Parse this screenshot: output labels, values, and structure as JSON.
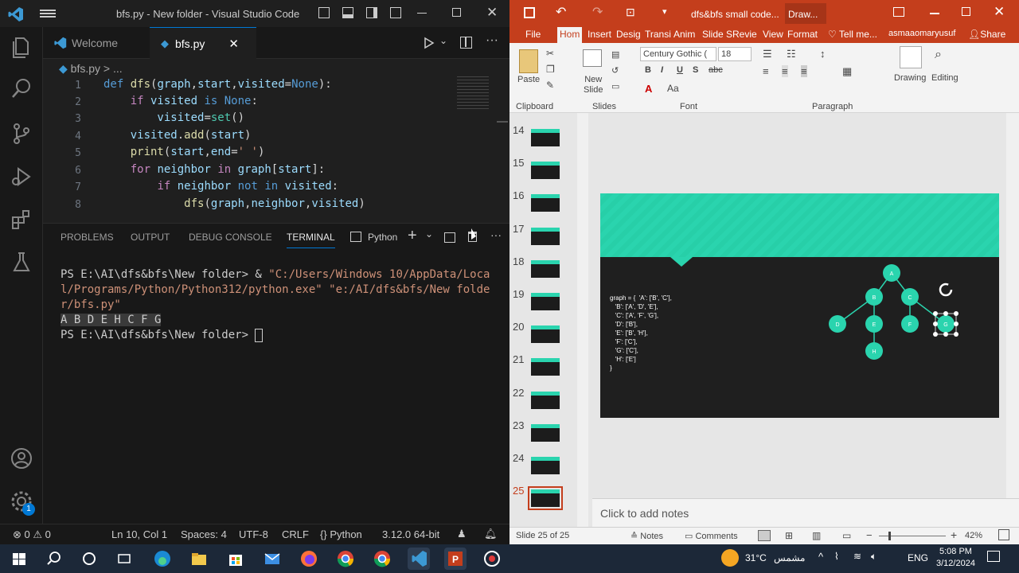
{
  "vscode": {
    "title": "bfs.py - New folder - Visual Studio Code",
    "tabs": [
      {
        "label": "Welcome"
      },
      {
        "label": "bfs.py"
      }
    ],
    "breadcrumb": {
      "file": "bfs.py",
      "rest": "..."
    },
    "code_lines": [
      {
        "n": "1",
        "text": "def dfs(graph,start,visited=None):"
      },
      {
        "n": "2",
        "text": "    if visited is None:"
      },
      {
        "n": "3",
        "text": "        visited=set()"
      },
      {
        "n": "4",
        "text": "    visited.add(start)"
      },
      {
        "n": "5",
        "text": "    print(start,end=' ')"
      },
      {
        "n": "6",
        "text": "    for neighbor in graph[start]:"
      },
      {
        "n": "7",
        "text": "        if neighbor not in visited:"
      },
      {
        "n": "8",
        "text": "            dfs(graph,neighbor,visited)"
      }
    ],
    "panel_tabs": {
      "problems": "PROBLEMS",
      "output": "OUTPUT",
      "debug": "DEBUG CONSOLE",
      "terminal": "TERMINAL",
      "python": "Python"
    },
    "terminal": {
      "line1": "PS E:\\AI\\dfs&bfs\\New folder> & ",
      "line1_str": "\"C:/Users/Windows 10/AppData/Local/Programs/Python/Python312/python.exe\" \"e:/AI/dfs&bfs/New folder/bfs.py\"",
      "output": "A B D E H C F G ",
      "prompt": "PS E:\\AI\\dfs&bfs\\New folder> "
    },
    "status": {
      "errors": "0",
      "warnings": "0",
      "position": "Ln 10, Col 1",
      "spaces": "Spaces: 4",
      "encoding": "UTF-8",
      "eol": "CRLF",
      "language": "Python",
      "interpreter": "3.12.0 64-bit",
      "badge": "1"
    }
  },
  "ppt": {
    "title": "dfs&bfs small code...",
    "context_tab": "Draw...",
    "tabs": [
      "File",
      "Hom",
      "Insert",
      "Desig",
      "Transi",
      "Anim",
      "Slide S",
      "Revie",
      "View",
      "Format",
      "Tell me...",
      "asmaaomaryusuf",
      "Share"
    ],
    "ribbon": {
      "paste": "Paste",
      "new_slide_1": "New",
      "new_slide_2": "Slide",
      "font_name": "Century Gothic (",
      "font_size": "18",
      "drawing": "Drawing",
      "editing": "Editing",
      "groups": [
        "Clipboard",
        "Slides",
        "Font",
        "Paragraph"
      ]
    },
    "thumbnails": [
      "14",
      "15",
      "16",
      "17",
      "18",
      "19",
      "20",
      "21",
      "22",
      "23",
      "24",
      "25"
    ],
    "slide_code": [
      "graph = {  'A': ['B', 'C'],",
      "   'B': ['A', 'D', 'E'],",
      "   'C': ['A', 'F', 'G'],",
      "   'D': ['B'],",
      "   'E': ['B', 'H'],",
      "   'F': ['C'],",
      "   'G': ['C'],",
      "   'H': ['E']",
      "}"
    ],
    "nodes": [
      "A",
      "B",
      "C",
      "D",
      "E",
      "F",
      "G",
      "H"
    ],
    "notes_placeholder": "Click to add notes",
    "status": {
      "slide": "Slide 25 of 25",
      "notes": "Notes",
      "comments": "Comments",
      "zoom": "42%"
    },
    "accent": "#2ad4ae"
  },
  "taskbar": {
    "weather": "31°C",
    "weather_label": "مشمس",
    "lang": "ENG",
    "time": "5:08 PM",
    "date": "3/12/2024"
  }
}
